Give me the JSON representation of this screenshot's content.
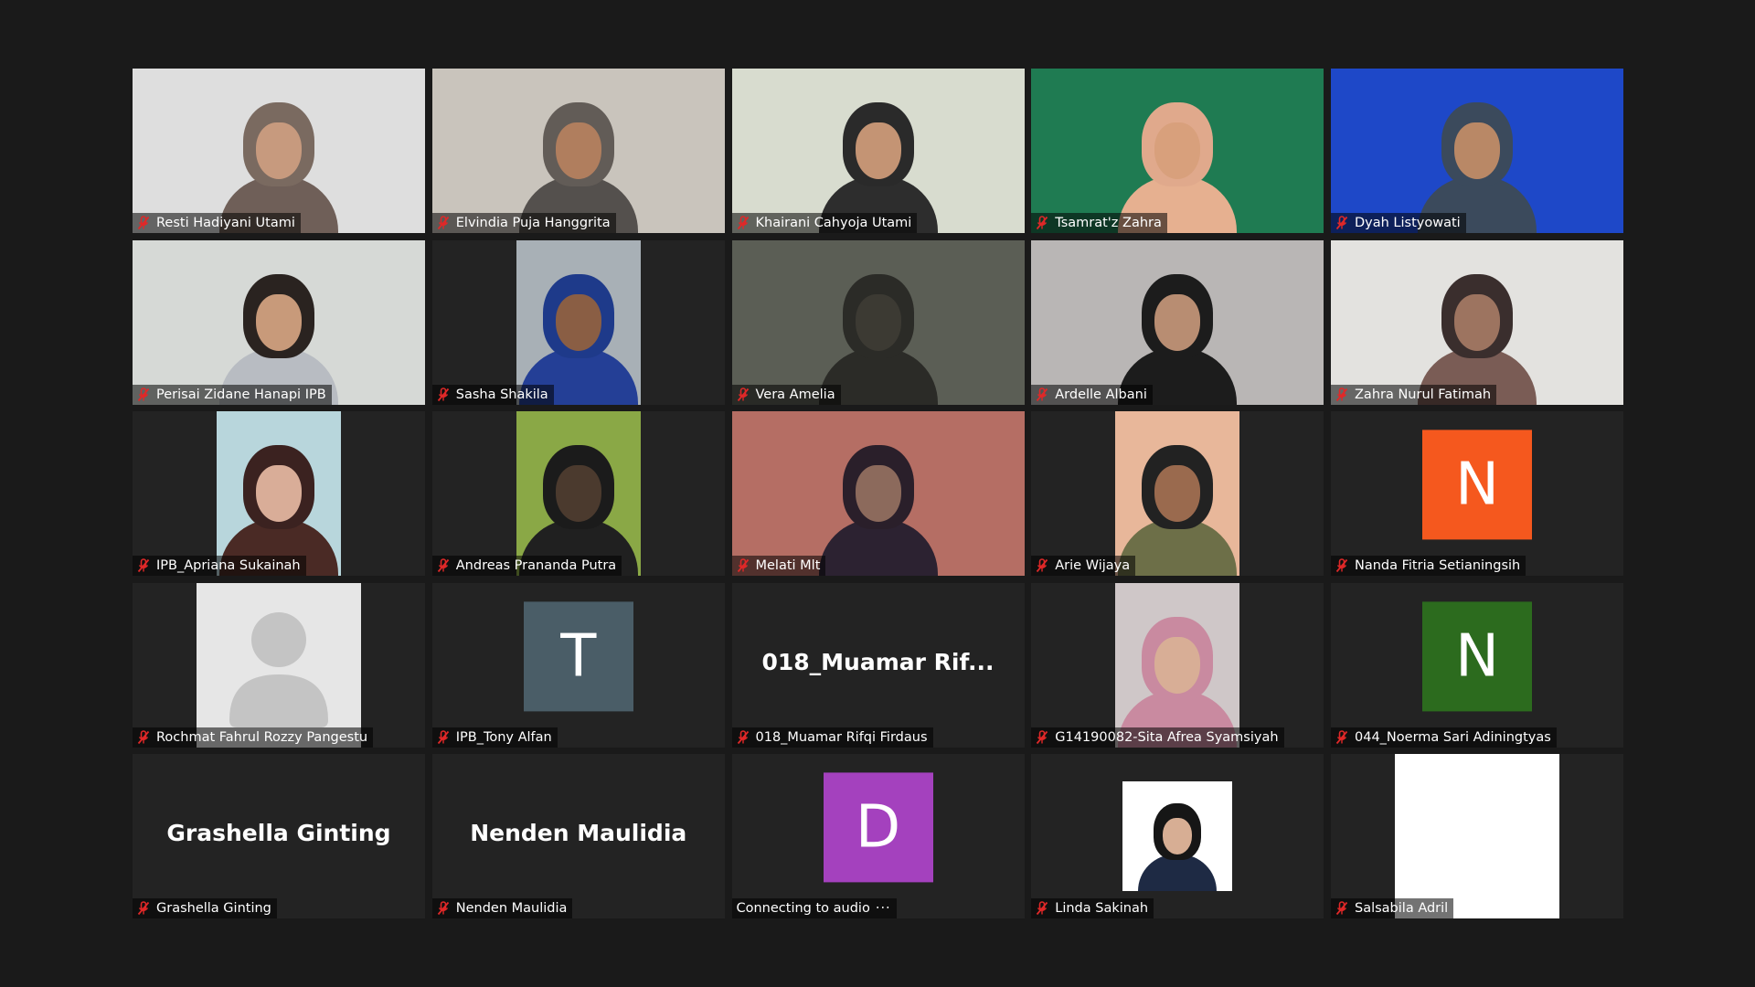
{
  "meeting": {
    "active_speaker_index": 3,
    "colors": {
      "background": "#1a1a1a",
      "tile": "#232323",
      "muted_mic": "#e02828",
      "speaker_border": "#ffffff"
    },
    "participants": [
      {
        "name": "Resti Hadiyani Utami",
        "muted": true,
        "type": "video",
        "bg": "#dedede",
        "hood": "#7a6a60",
        "skin": "#c79a7e",
        "shirt": "#6f5f58"
      },
      {
        "name": "Elvindia Puja Hanggrita",
        "muted": true,
        "type": "video",
        "bg": "#c9c4bc",
        "hood": "#625c57",
        "skin": "#b07e5e",
        "shirt": "#54504d"
      },
      {
        "name": "Khairani Cahyoja Utami",
        "muted": true,
        "type": "video",
        "bg": "#d8dccf",
        "hood": "#2a2a2a",
        "skin": "#c49474",
        "shirt": "#2d2d2d"
      },
      {
        "name": "Tsamrat'z Zahra",
        "muted": true,
        "type": "video",
        "bg": "#1f7b52",
        "hood": "#e0a98c",
        "skin": "#d8a07c",
        "shirt": "#e6b090"
      },
      {
        "name": "Dyah Listyowati",
        "muted": true,
        "type": "video",
        "bg": "#1e48c8",
        "hood": "#3b4a5c",
        "skin": "#b98866",
        "shirt": "#3b4a5c"
      },
      {
        "name": "Perisai Zidane Hanapi IPB",
        "muted": true,
        "type": "video",
        "bg": "#d6d9d6",
        "hood": "#2a2320",
        "skin": "#c89a7a",
        "shirt": "#b8bcc2"
      },
      {
        "name": "Sasha Shakila",
        "muted": true,
        "type": "video",
        "bg": "#a8b0b6",
        "hood": "#1e3a8a",
        "skin": "#8a5e44",
        "shirt": "#243f96",
        "narrow": true
      },
      {
        "name": "Vera Amelia",
        "muted": true,
        "type": "video",
        "bg": "#5b5e55",
        "hood": "#2b2b27",
        "skin": "#3c3a33",
        "shirt": "#2b2b27"
      },
      {
        "name": "Ardelle Albani",
        "muted": true,
        "type": "video",
        "bg": "#b9b6b5",
        "hood": "#1c1c1c",
        "skin": "#b88d72",
        "shirt": "#1c1c1c"
      },
      {
        "name": "Zahra Nurul Fatimah",
        "muted": true,
        "type": "video",
        "bg": "#e3e2df",
        "hood": "#3a2e2d",
        "skin": "#9d7460",
        "shirt": "#7a5c55"
      },
      {
        "name": "IPB_Apriana Sukainah",
        "muted": true,
        "type": "video",
        "bg": "#b8d6dc",
        "hood": "#3b2220",
        "skin": "#d9ad98",
        "shirt": "#4a2a25",
        "narrow": true
      },
      {
        "name": "Andreas Prananda Putra",
        "muted": true,
        "type": "video",
        "bg": "#8aa846",
        "hood": "#1b1b1b",
        "skin": "#4b3a2e",
        "shirt": "#202020",
        "narrow": true
      },
      {
        "name": "Melati Mlt",
        "muted": true,
        "type": "video",
        "bg": "#b56e64",
        "hood": "#2a1f2a",
        "skin": "#8c6a5c",
        "shirt": "#2c2231"
      },
      {
        "name": "Arie Wijaya",
        "muted": true,
        "type": "video",
        "bg": "#e8b79a",
        "hood": "#222222",
        "skin": "#9a6a4e",
        "shirt": "#6d6f48",
        "narrow": true
      },
      {
        "name": "Nanda Fitria Setianingsih",
        "muted": true,
        "type": "avatar",
        "initial": "N",
        "color": "#f5581e"
      },
      {
        "name": "Rochmat Fahrul Rozzy Pangestu",
        "muted": true,
        "type": "placeholder"
      },
      {
        "name": "IPB_Tony Alfan",
        "muted": true,
        "type": "avatar",
        "initial": "T",
        "color": "#4a5d67"
      },
      {
        "name": "018_Muamar Rifqi Firdaus",
        "muted": true,
        "type": "text",
        "display": "018_Muamar  Rif..."
      },
      {
        "name": "G14190082-Sita Afrea Syamsiyah",
        "muted": true,
        "type": "video",
        "bg": "#cfc7c8",
        "hood": "#c98aa0",
        "skin": "#d8ae96",
        "shirt": "#c98aa0",
        "narrow": true
      },
      {
        "name": "044_Noerma Sari Adiningtyas",
        "muted": true,
        "type": "avatar",
        "initial": "N",
        "color": "#2c6b1e"
      },
      {
        "name": "Grashella Ginting",
        "muted": true,
        "type": "text",
        "display": "Grashella Ginting"
      },
      {
        "name": "Nenden Maulidia",
        "muted": true,
        "type": "text",
        "display": "Nenden Maulidia"
      },
      {
        "name": "Connecting to audio",
        "muted": false,
        "type": "avatar",
        "initial": "D",
        "color": "#a441be",
        "connecting": true
      },
      {
        "name": "Linda Sakinah",
        "muted": true,
        "type": "photo",
        "bg": "#ffffff",
        "hood": "#161616",
        "skin": "#d7ae94",
        "shirt": "#1e2a44"
      },
      {
        "name": "Salsabila Adril",
        "muted": true,
        "type": "blank"
      }
    ]
  }
}
